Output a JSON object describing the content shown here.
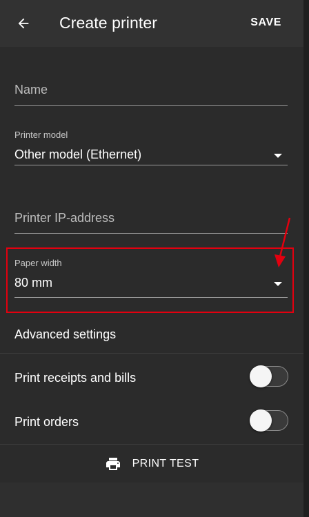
{
  "toolbar": {
    "title": "Create printer",
    "save_label": "SAVE",
    "back_icon": "arrow-back-icon"
  },
  "form": {
    "name_placeholder": "Name",
    "printer_model": {
      "label": "Printer model",
      "value": "Other model (Ethernet)"
    },
    "ip_placeholder": "Printer IP-address",
    "paper_width": {
      "label": "Paper width",
      "value": "80 mm"
    }
  },
  "advanced": {
    "title": "Advanced settings",
    "toggles": [
      {
        "label": "Print receipts and bills",
        "enabled": false
      },
      {
        "label": "Print orders",
        "enabled": false
      }
    ]
  },
  "print_test": {
    "label": "PRINT TEST",
    "icon": "printer-icon"
  },
  "colors": {
    "background": "#2b2b2b",
    "toolbar": "#323232",
    "highlight": "#e3000f"
  }
}
